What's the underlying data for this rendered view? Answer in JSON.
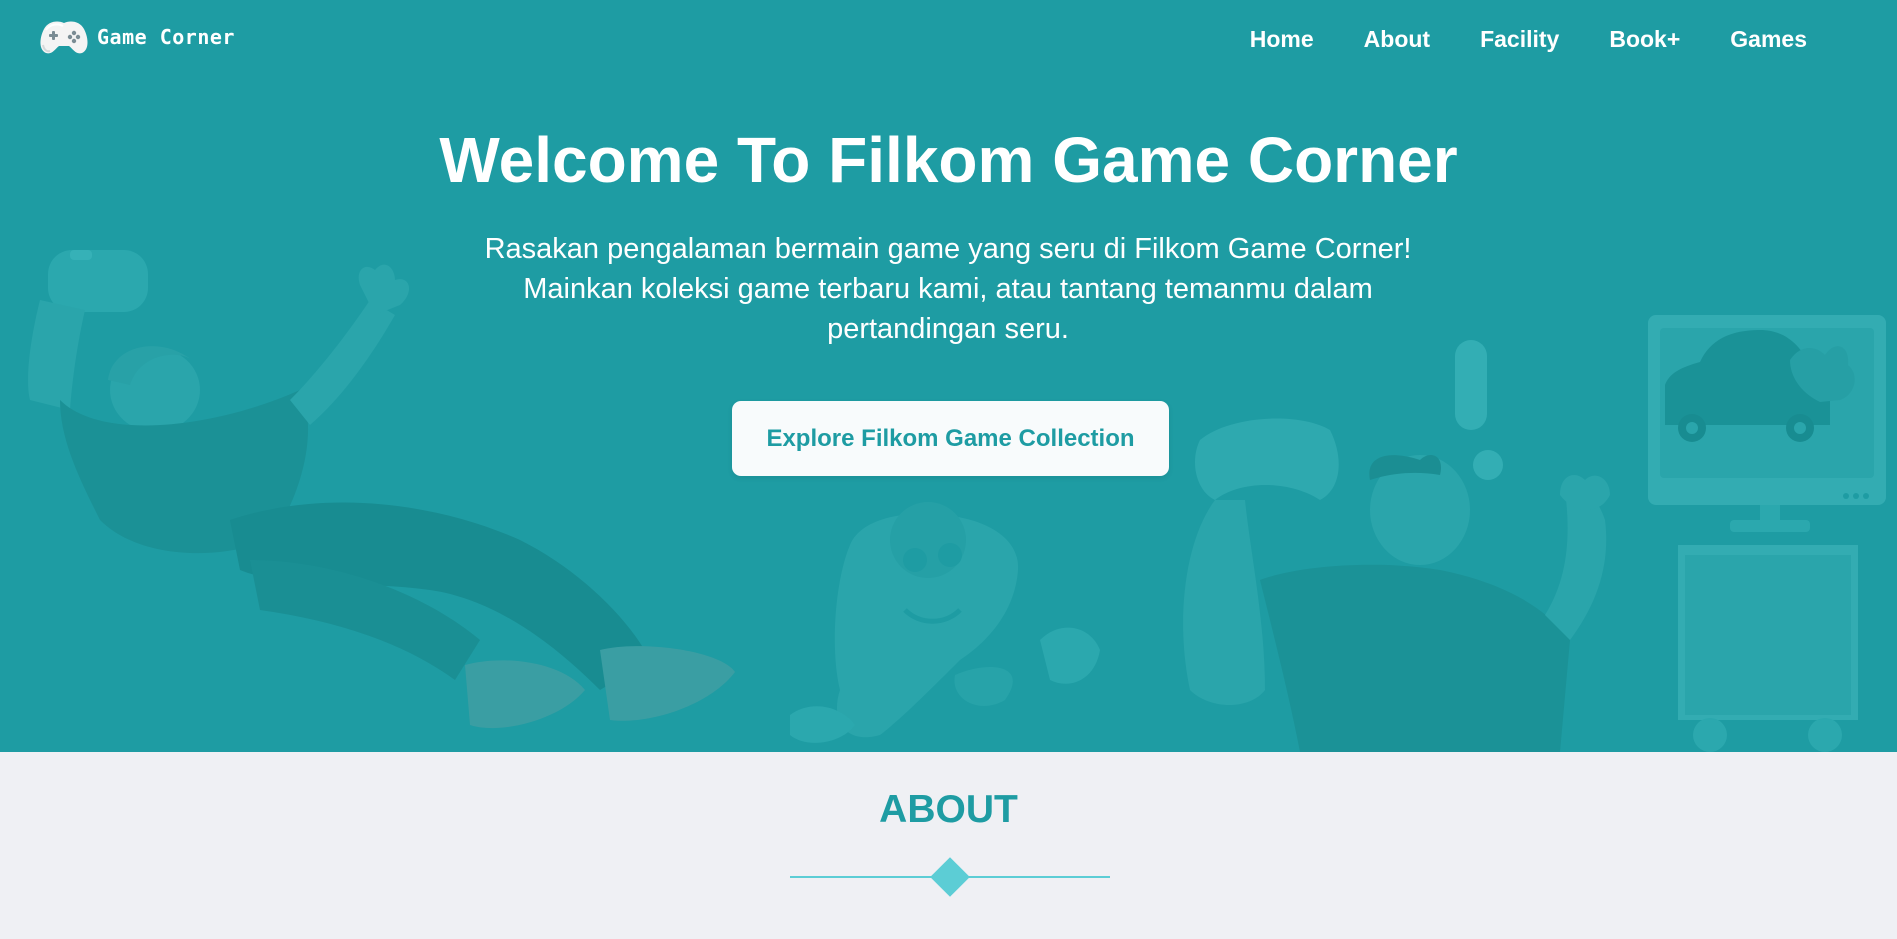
{
  "brand": {
    "name": "Game Corner",
    "logo_icon": "gamepad-icon"
  },
  "nav": {
    "items": [
      {
        "label": "Home"
      },
      {
        "label": "About"
      },
      {
        "label": "Facility"
      },
      {
        "label": "Book+"
      },
      {
        "label": "Games"
      }
    ]
  },
  "hero": {
    "title": "Welcome To Filkom Game Corner",
    "description": "Rasakan pengalaman bermain game yang seru di Filkom Game Corner! Mainkan koleksi game terbaru kami, atau tantang temanmu dalam pertandingan seru.",
    "cta_label": "Explore Filkom Game Collection",
    "illustrations": [
      "falling-gamer-illustration",
      "gamepad-mascot-illustration",
      "cheering-gamer-illustration",
      "tv-console-illustration"
    ]
  },
  "about": {
    "title": "ABOUT",
    "divider_icon": "diamond-divider-icon"
  },
  "colors": {
    "primary": "#1e9ca3",
    "accent": "#5ccdd5",
    "background": "#eff0f4",
    "button_bg": "#f8fbfc",
    "text_light": "#ffffff"
  }
}
